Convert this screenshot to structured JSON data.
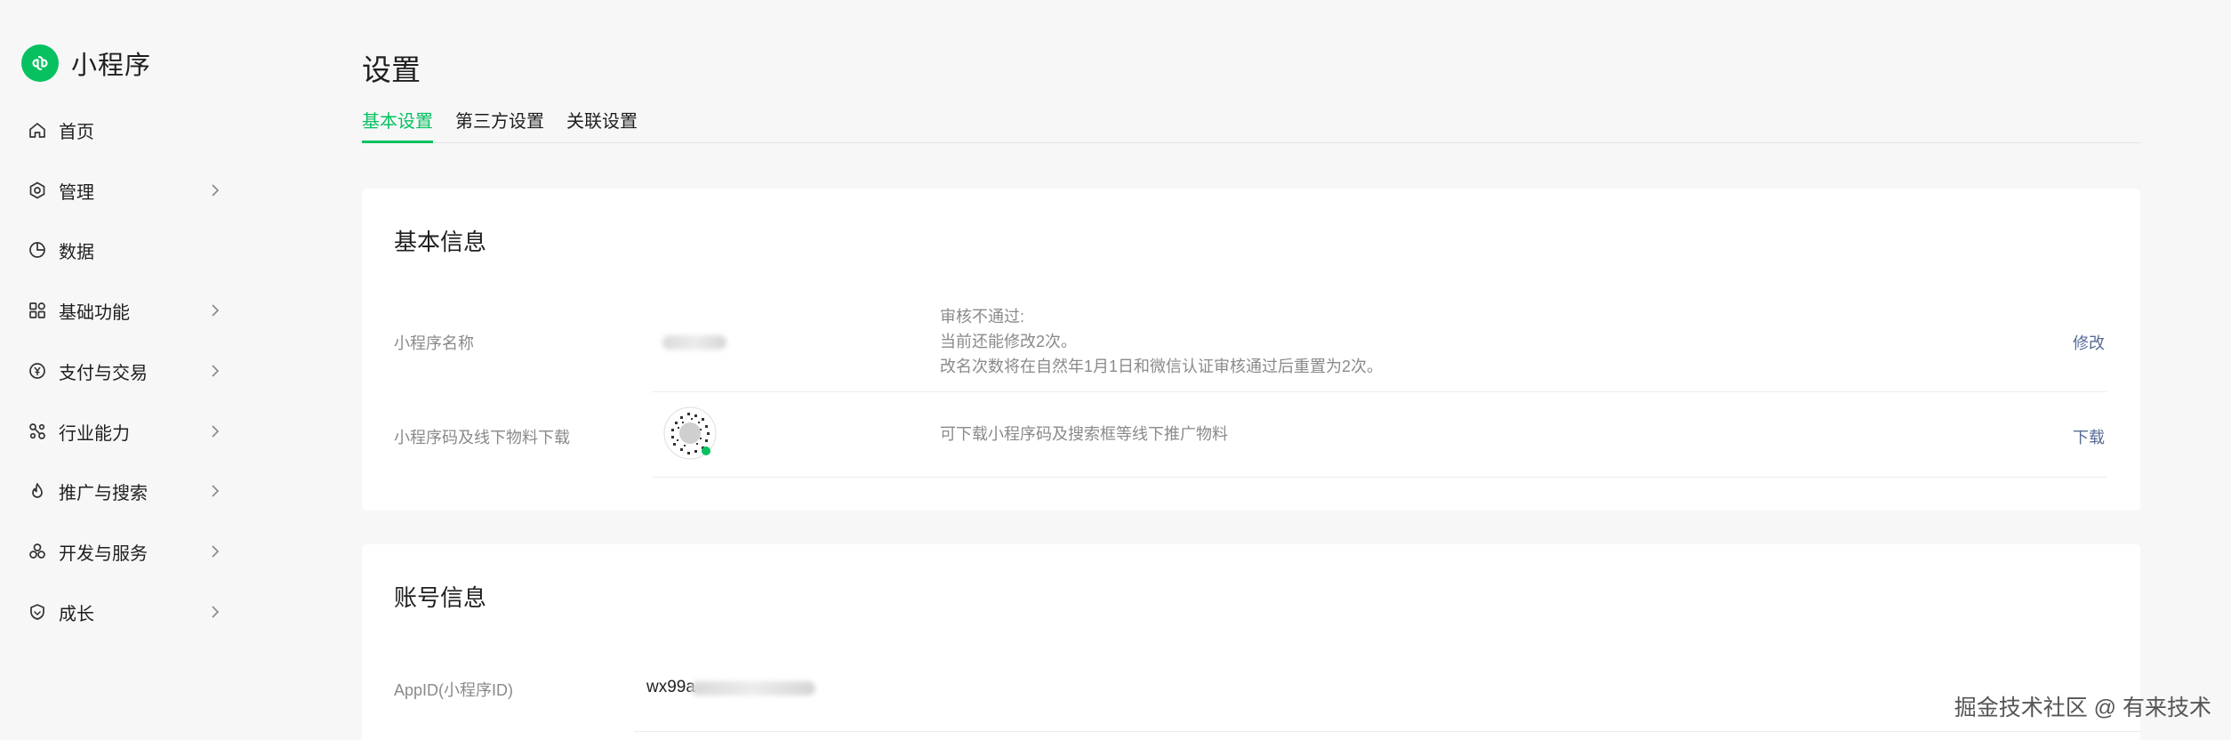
{
  "brand": {
    "name": "小程序",
    "logo_icon": "miniprogram-logo-icon",
    "logo_color": "#07c160"
  },
  "sidebar": {
    "items": [
      {
        "label": "首页",
        "icon": "home-icon",
        "has_children": false
      },
      {
        "label": "管理",
        "icon": "hexagon-icon",
        "has_children": true
      },
      {
        "label": "数据",
        "icon": "pie-chart-icon",
        "has_children": false
      },
      {
        "label": "基础功能",
        "icon": "grid-icon",
        "has_children": true
      },
      {
        "label": "支付与交易",
        "icon": "yuan-coin-icon",
        "has_children": true
      },
      {
        "label": "行业能力",
        "icon": "nodes-icon",
        "has_children": true
      },
      {
        "label": "推广与搜索",
        "icon": "flame-icon",
        "has_children": true
      },
      {
        "label": "开发与服务",
        "icon": "cluster-icon",
        "has_children": true
      },
      {
        "label": "成长",
        "icon": "leaf-badge-icon",
        "has_children": true
      }
    ]
  },
  "main": {
    "title": "设置",
    "tabs": [
      {
        "label": "基本设置",
        "active": true
      },
      {
        "label": "第三方设置",
        "active": false
      },
      {
        "label": "关联设置",
        "active": false
      }
    ],
    "basic_info": {
      "title": "基本信息",
      "rows": [
        {
          "label": "小程序名称",
          "desc_lines": [
            "审核不通过:",
            "当前还能修改2次。",
            "改名次数将在自然年1月1日和微信认证审核通过后重置为2次。"
          ],
          "action": "修改"
        },
        {
          "label": "小程序码及线下物料下载",
          "desc_lines": [
            "可下载小程序码及搜索框等线下推广物料"
          ],
          "action": "下载"
        }
      ]
    },
    "account_info": {
      "title": "账号信息",
      "rows": [
        {
          "label": "AppID(小程序ID)",
          "value": "wx99a"
        }
      ]
    }
  },
  "watermark": "掘金技术社区 @ 有来技术",
  "colors": {
    "accent": "#07c160",
    "link": "#576b95",
    "muted": "#8a8a8a"
  }
}
